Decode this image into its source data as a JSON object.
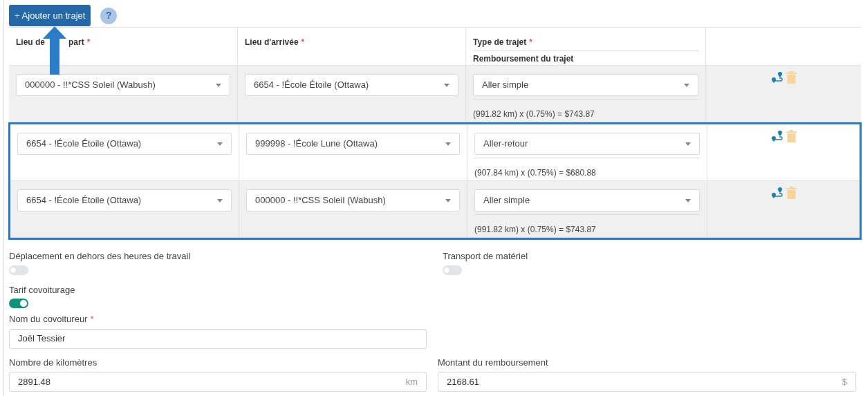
{
  "add_button": {
    "icon": "+",
    "label": "Ajouter un trajet"
  },
  "help_button": {
    "label": "?"
  },
  "table": {
    "columns": [
      {
        "parts": [
          "Lieu de",
          "part"
        ],
        "mark": "*"
      },
      {
        "parts": [
          "Lieu d'arrivée"
        ],
        "mark": "*"
      },
      {
        "parts": [
          "Type de trajet"
        ],
        "mark": "*",
        "sublabel": "Remboursement du trajet"
      }
    ],
    "rows": [
      {
        "departure": "000000 - !!*CSS Soleil (Wabush)",
        "arrival": "6654 - !École Étoile (Ottawa)",
        "type": "Aller simple",
        "reimbursement": "(991.82 km) x (0.75%) = $743.87",
        "highlighted": false
      },
      {
        "departure": "6654 - !École Étoile (Ottawa)",
        "arrival": "999998 - !École Lune (Ottawa)",
        "type": "Aller-retour",
        "reimbursement": "(907.84 km) x (0.75%) = $680.88",
        "highlighted": true
      },
      {
        "departure": "6654 - !École Étoile (Ottawa)",
        "arrival": "000000 - !!*CSS Soleil (Wabush)",
        "type": "Aller simple",
        "reimbursement": "(991.82 km) x (0.75%) = $743.87",
        "highlighted": true
      }
    ]
  },
  "toggles": [
    {
      "label": "Déplacement en dehors des heures de travail",
      "on": false
    },
    {
      "label": "Transport de matériel",
      "on": false
    },
    {
      "label": "Tarif covoiturage",
      "on": true
    }
  ],
  "carpooler": {
    "label": "Nom du covoitureur",
    "mark": "*",
    "value": "Joël Tessier"
  },
  "kilometers": {
    "label": "Nombre de kilomètres",
    "value": "2891.48",
    "unit": "km"
  },
  "amount": {
    "label": "Montant du remboursement",
    "value": "2168.61",
    "unit": "$"
  }
}
